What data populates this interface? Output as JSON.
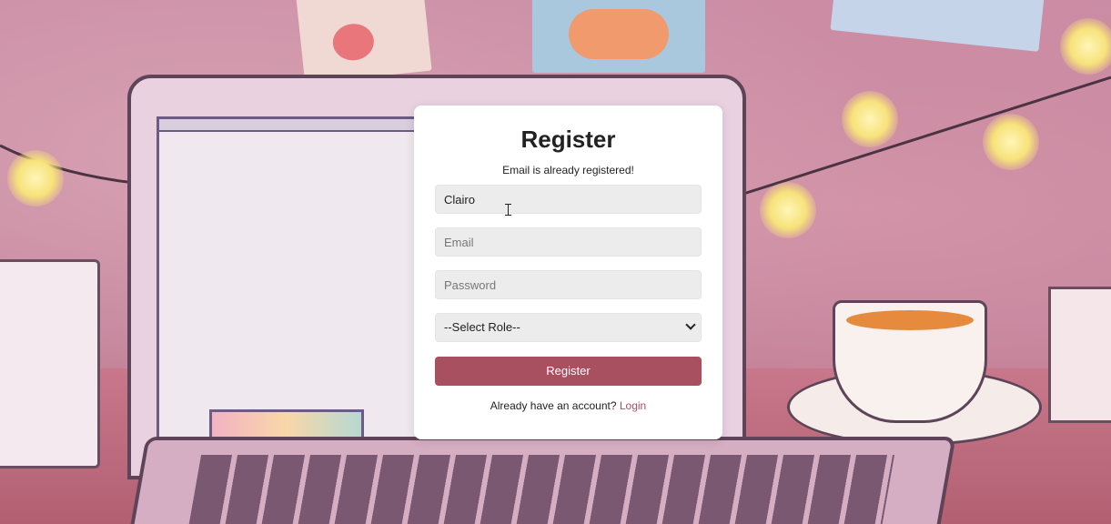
{
  "register_card": {
    "title": "Register",
    "message": "Email is already registered!",
    "name_value": "Clairo",
    "email_placeholder": "Email",
    "password_placeholder": "Password",
    "role_selected": "--Select Role--",
    "submit_label": "Register",
    "footer_text": "Already have an account? ",
    "login_link": "Login"
  },
  "colors": {
    "accent": "#a84f60",
    "card_bg": "#ffffff",
    "input_bg": "#ececec"
  },
  "icons": {
    "select_arrow": "chevron-down-icon",
    "text_cursor": "i-beam-cursor-icon"
  }
}
